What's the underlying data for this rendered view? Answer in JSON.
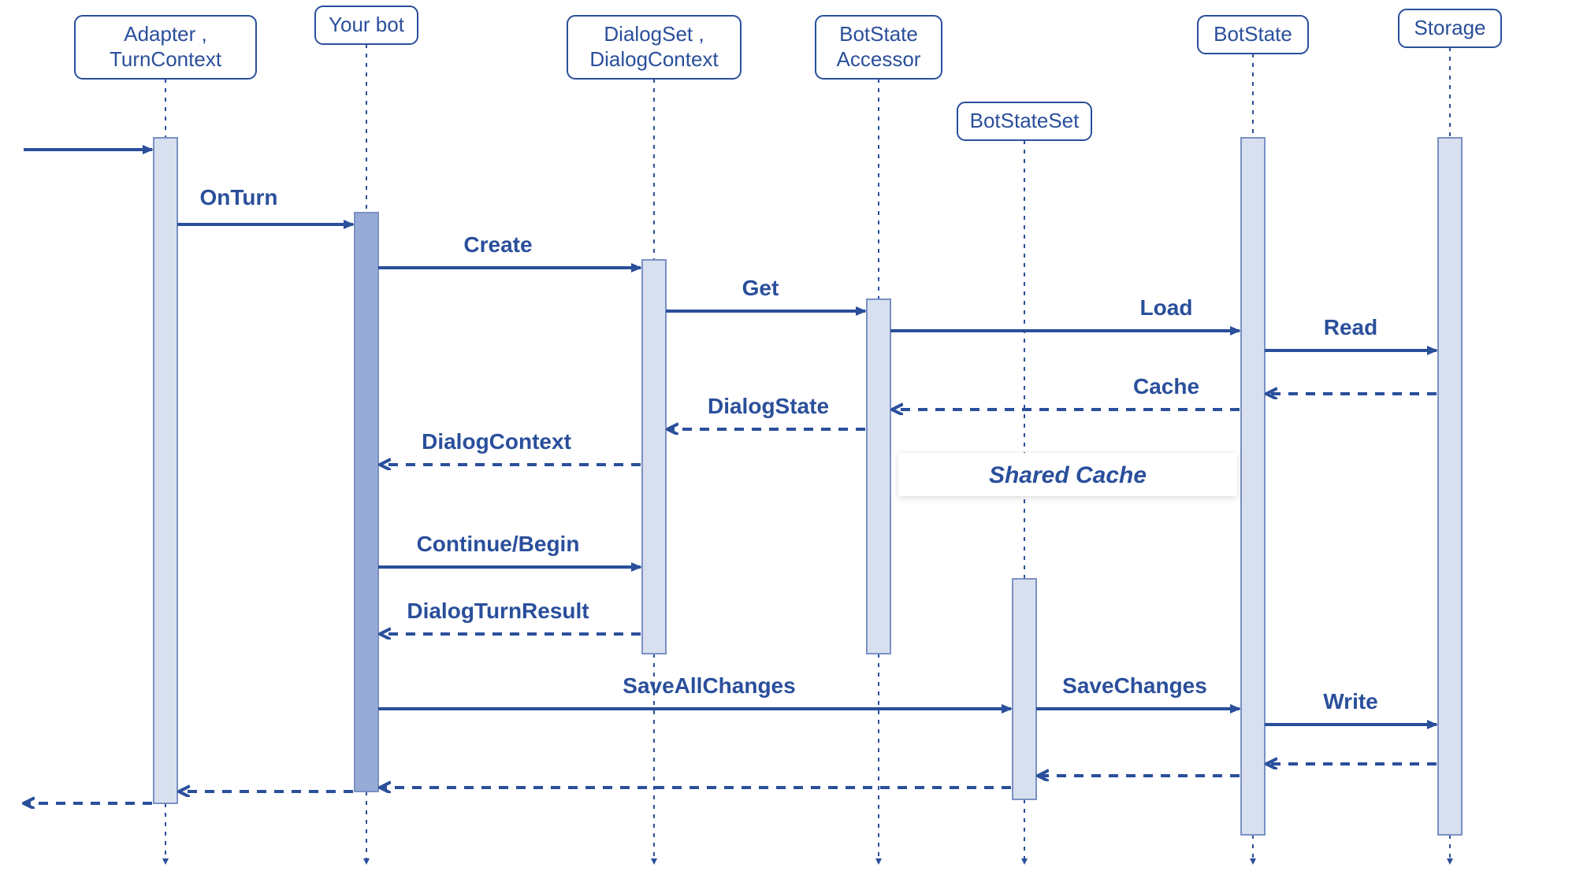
{
  "participants": {
    "adapter": {
      "label1": "Adapter ,",
      "label2": "TurnContext"
    },
    "bot": {
      "label1": "Your bot",
      "label2": ""
    },
    "dialog": {
      "label1": "DialogSet ,",
      "label2": "DialogContext"
    },
    "accessor": {
      "label1": "BotState",
      "label2": "Accessor"
    },
    "stateset": {
      "label1": "BotStateSet",
      "label2": ""
    },
    "botstate": {
      "label1": "BotState",
      "label2": ""
    },
    "storage": {
      "label1": "Storage",
      "label2": ""
    }
  },
  "messages": {
    "onturn": "OnTurn",
    "create": "Create",
    "get": "Get",
    "load": "Load",
    "read": "Read",
    "cache": "Cache",
    "dialogstate": "DialogState",
    "dialogcontext": "DialogContext",
    "continuebegin": "Continue/Begin",
    "dialogturnresult": "DialogTurnResult",
    "saveallchanges": "SaveAllChanges",
    "savechanges": "SaveChanges",
    "write": "Write"
  },
  "note": {
    "shared_cache": "Shared Cache"
  },
  "chart_data": {
    "type": "sequence-diagram",
    "participants": [
      "Adapter / TurnContext",
      "Your bot",
      "DialogSet / DialogContext",
      "BotState Accessor",
      "BotStateSet",
      "BotState",
      "Storage"
    ],
    "messages": [
      {
        "from": "external",
        "to": "Adapter / TurnContext",
        "label": "",
        "kind": "sync"
      },
      {
        "from": "Adapter / TurnContext",
        "to": "Your bot",
        "label": "OnTurn",
        "kind": "sync"
      },
      {
        "from": "Your bot",
        "to": "DialogSet / DialogContext",
        "label": "Create",
        "kind": "sync"
      },
      {
        "from": "DialogSet / DialogContext",
        "to": "BotState Accessor",
        "label": "Get",
        "kind": "sync"
      },
      {
        "from": "BotState Accessor",
        "to": "BotState",
        "label": "Load",
        "kind": "sync"
      },
      {
        "from": "BotState",
        "to": "Storage",
        "label": "Read",
        "kind": "sync"
      },
      {
        "from": "Storage",
        "to": "BotState",
        "label": "",
        "kind": "return"
      },
      {
        "from": "BotState",
        "to": "BotState Accessor",
        "label": "Cache",
        "kind": "return"
      },
      {
        "from": "BotState Accessor",
        "to": "DialogSet / DialogContext",
        "label": "DialogState",
        "kind": "return"
      },
      {
        "from": "DialogSet / DialogContext",
        "to": "Your bot",
        "label": "DialogContext",
        "kind": "return"
      },
      {
        "from": "Your bot",
        "to": "DialogSet / DialogContext",
        "label": "Continue/Begin",
        "kind": "sync"
      },
      {
        "from": "DialogSet / DialogContext",
        "to": "Your bot",
        "label": "DialogTurnResult",
        "kind": "return"
      },
      {
        "from": "Your bot",
        "to": "BotStateSet",
        "label": "SaveAllChanges",
        "kind": "sync"
      },
      {
        "from": "BotStateSet",
        "to": "BotState",
        "label": "SaveChanges",
        "kind": "sync"
      },
      {
        "from": "BotState",
        "to": "Storage",
        "label": "Write",
        "kind": "sync"
      },
      {
        "from": "Storage",
        "to": "BotState",
        "label": "",
        "kind": "return"
      },
      {
        "from": "BotState",
        "to": "BotStateSet",
        "label": "",
        "kind": "return"
      },
      {
        "from": "BotStateSet",
        "to": "Your bot",
        "label": "",
        "kind": "return"
      },
      {
        "from": "Your bot",
        "to": "Adapter / TurnContext",
        "label": "",
        "kind": "return"
      },
      {
        "from": "Adapter / TurnContext",
        "to": "external",
        "label": "",
        "kind": "return"
      }
    ],
    "notes": [
      {
        "over": [
          "BotState Accessor",
          "BotState"
        ],
        "text": "Shared Cache"
      }
    ]
  }
}
